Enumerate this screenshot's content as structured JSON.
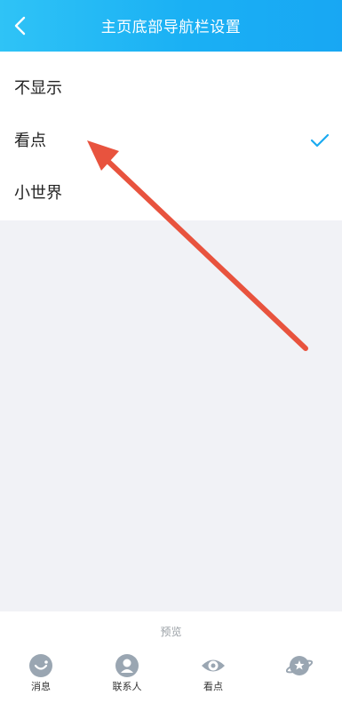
{
  "header": {
    "title": "主页底部导航栏设置",
    "back_icon": "chevron-left-icon"
  },
  "options": [
    {
      "label": "不显示",
      "selected": false
    },
    {
      "label": "看点",
      "selected": true
    },
    {
      "label": "小世界",
      "selected": false
    }
  ],
  "preview": {
    "label": "预览",
    "tabs": [
      {
        "label": "消息",
        "icon": "message-icon"
      },
      {
        "label": "联系人",
        "icon": "contact-icon"
      },
      {
        "label": "看点",
        "icon": "eye-icon"
      },
      {
        "label": "",
        "icon": "planet-icon"
      }
    ]
  },
  "colors": {
    "header": "#18a7f3",
    "check": "#1aaaf0",
    "arrow": "#e8533e",
    "nav_icon": "#9aa6b2"
  }
}
